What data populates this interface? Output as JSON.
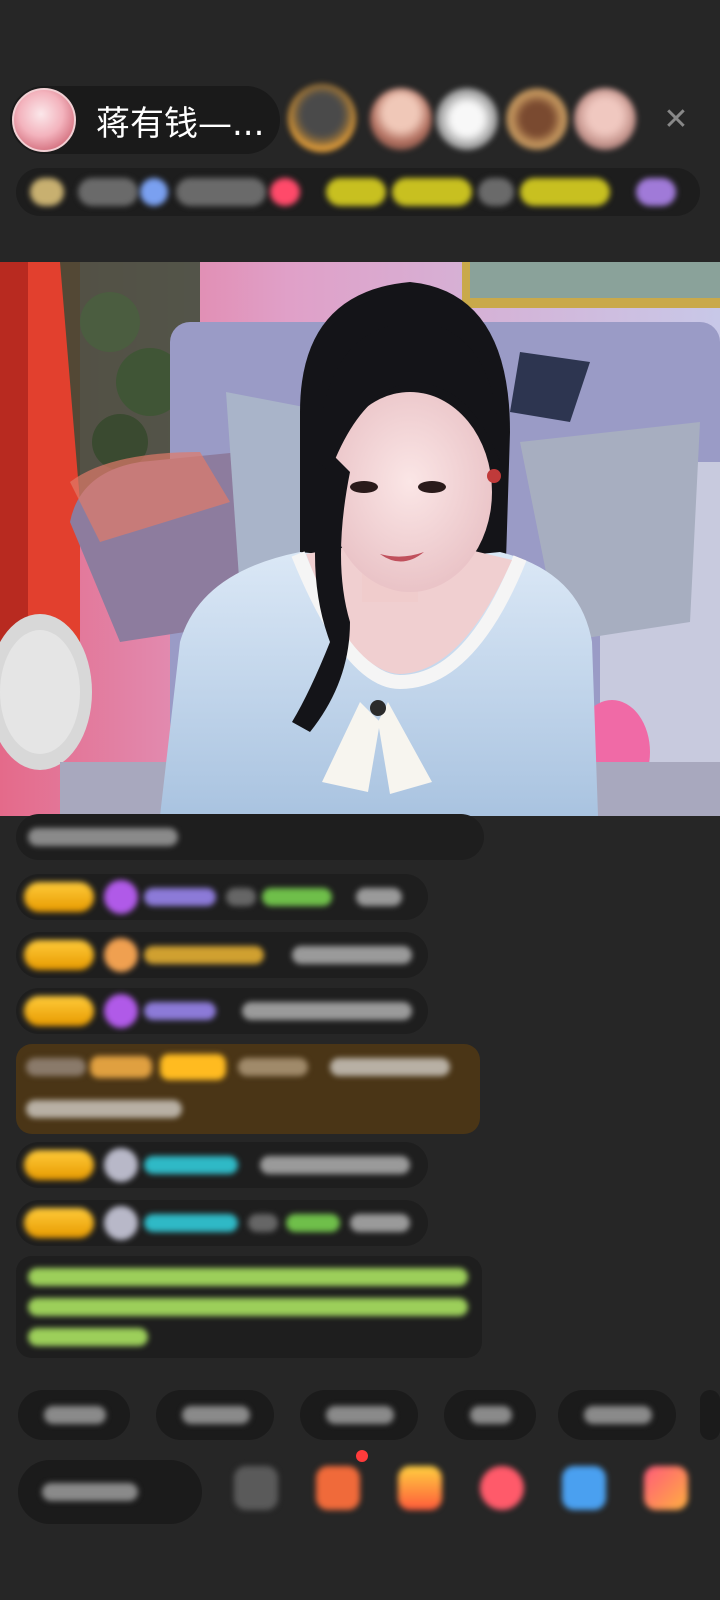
{
  "header": {
    "host_name": "蒋有钱—...",
    "close_icon": "close-icon",
    "viewer_avatars": [
      "viewer-avatar-1",
      "viewer-avatar-2",
      "viewer-avatar-3",
      "viewer-avatar-4",
      "viewer-avatar-5"
    ]
  },
  "colors": {
    "background": "#262626",
    "panel": "#1e1e1e",
    "badge_gold": "#ffcb3a",
    "username_purple": "#8c7ad8",
    "username_teal": "#2fb9c6",
    "username_green": "#6fbf4a",
    "highlight_brown": "#4a3516",
    "system_text_green": "#9ccf5a",
    "notification_red": "#ff3b3b"
  },
  "chat": {
    "messages": [
      {
        "type": "system"
      },
      {
        "type": "user",
        "icon": "diamond-icon",
        "color": "purple"
      },
      {
        "type": "user",
        "icon": "flame-icon",
        "color": "orange"
      },
      {
        "type": "user",
        "icon": "diamond-icon",
        "color": "purple"
      },
      {
        "type": "highlight"
      },
      {
        "type": "user",
        "icon": "chat-bubble-icon",
        "color": "teal"
      },
      {
        "type": "user",
        "icon": "chat-bubble-icon",
        "color": "teal"
      },
      {
        "type": "system-green"
      }
    ]
  },
  "bottom_bar": {
    "chip_icons": [
      "chip-1",
      "chip-2",
      "chip-3",
      "chip-4",
      "chip-5"
    ],
    "icons": [
      "emoji-icon",
      "shop-icon",
      "gift-box-icon",
      "heart-icon",
      "chat-icon",
      "more-grid-icon"
    ]
  }
}
